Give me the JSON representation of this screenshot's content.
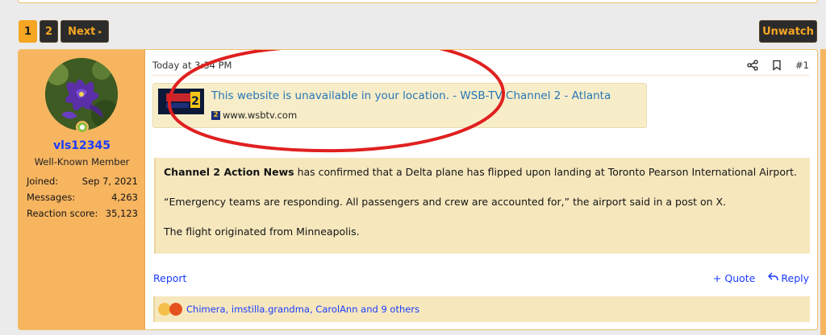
{
  "pagination": {
    "pages": [
      "1",
      "2"
    ],
    "current": "1",
    "next_label": "Next"
  },
  "watch": {
    "label": "Unwatch"
  },
  "user": {
    "name": "vls12345",
    "title": "Well-Known Member",
    "stats": [
      {
        "label": "Joined:",
        "value": "Sep 7, 2021"
      },
      {
        "label": "Messages:",
        "value": "4,263"
      },
      {
        "label": "Reaction score:",
        "value": "35,123"
      }
    ]
  },
  "post": {
    "timestamp": "Today at 3:34 PM",
    "number": "#1",
    "unfurl": {
      "title": "This website is unavailable in your location. - WSB-TV Channel 2 - Atlanta",
      "domain": "www.wsbtv.com",
      "thumb_text": "ACTION NEWS 2",
      "favicon_text": "2"
    },
    "quote": {
      "p1_bold": "Channel 2 Action News",
      "p1_rest": " has confirmed that a Delta plane has flipped upon landing at Toronto Pearson International Airport.",
      "p2": "“Emergency teams are responding. All passengers and crew are accounted for,” the airport said in a post on X.",
      "p3": "The flight originated from Minneapolis."
    },
    "actions": {
      "report": "Report",
      "quote": "+ Quote",
      "reply": "Reply"
    },
    "reactions": {
      "text": "Chimera, imstilla.grandma, CarolAnn and 9 others"
    }
  },
  "colors": {
    "accent": "#f5a623",
    "link": "#1a3cff",
    "annotation": "#e02020"
  }
}
